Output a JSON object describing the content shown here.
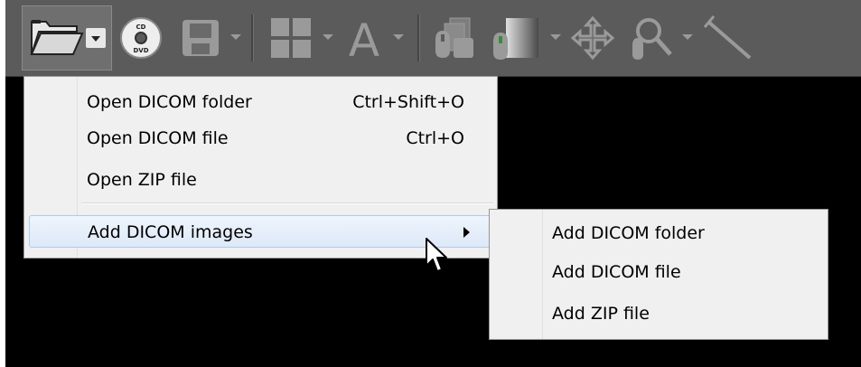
{
  "toolbar": {
    "buttons": [
      {
        "name": "open-folder-icon"
      },
      {
        "name": "cd-dvd-icon",
        "text_top": "CD",
        "text_bottom": "DVD"
      },
      {
        "name": "save-icon"
      },
      {
        "name": "layout-grid-icon"
      },
      {
        "name": "text-annotation-icon",
        "glyph": "A"
      },
      {
        "name": "series-icon"
      },
      {
        "name": "window-level-icon"
      },
      {
        "name": "pan-icon"
      },
      {
        "name": "zoom-icon"
      },
      {
        "name": "measure-line-icon"
      }
    ]
  },
  "menu": {
    "items": [
      {
        "label": "Open DICOM folder",
        "shortcut": "Ctrl+Shift+O"
      },
      {
        "label": "Open DICOM file",
        "shortcut": "Ctrl+O"
      },
      {
        "label": "Open ZIP file",
        "shortcut": ""
      },
      {
        "label": "Add DICOM images",
        "shortcut": "",
        "submenu": true
      }
    ]
  },
  "submenu": {
    "items": [
      {
        "label": "Add DICOM folder"
      },
      {
        "label": "Add DICOM file"
      },
      {
        "label": "Add ZIP file"
      }
    ]
  },
  "colors": {
    "toolbar_bg": "#5b5b5b",
    "icon_gray": "#9a9a9a",
    "menu_bg": "#f0f0f0",
    "highlight": "#dde9f7"
  }
}
